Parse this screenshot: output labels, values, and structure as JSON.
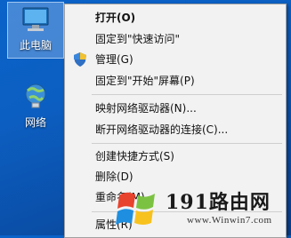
{
  "desktop": {
    "icons": [
      {
        "label": "此电脑",
        "icon": "computer-icon"
      },
      {
        "label": "网络",
        "icon": "network-icon"
      }
    ]
  },
  "context_menu": {
    "items": [
      {
        "label": "打开(O)",
        "bold": true
      },
      {
        "label": "固定到\"快速访问\""
      },
      {
        "label": "管理(G)",
        "icon": "shield-icon"
      },
      {
        "label": "固定到\"开始\"屏幕(P)"
      },
      {
        "label": "映射网络驱动器(N)..."
      },
      {
        "label": "断开网络驱动器的连接(C)..."
      },
      {
        "label": "创建快捷方式(S)"
      },
      {
        "label": "删除(D)"
      },
      {
        "label": "重命名(M)"
      },
      {
        "label": "属性(R)"
      }
    ]
  },
  "watermark": {
    "title": "191路由网",
    "url": "www.Winwin7.com"
  },
  "colors": {
    "desktop_bg": "#0a5cbf",
    "menu_bg": "#f2f2f2",
    "menu_border": "#a0a0a0"
  }
}
